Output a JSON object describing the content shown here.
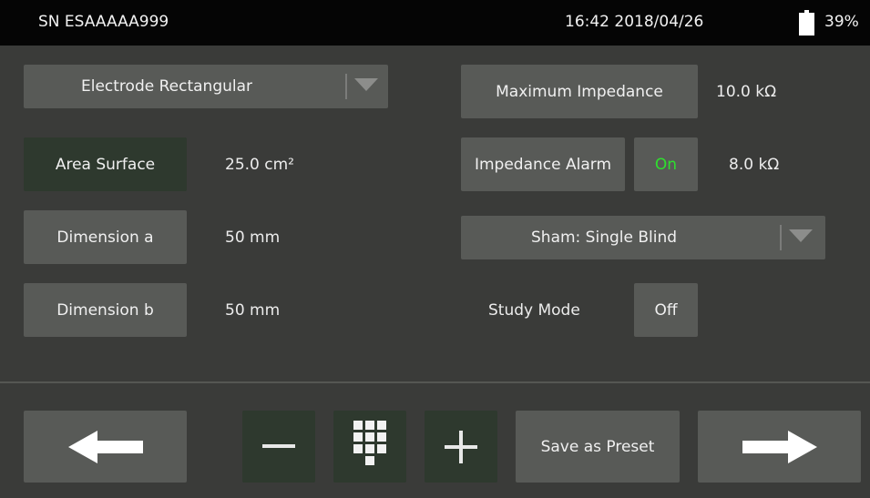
{
  "status_bar": {
    "serial": "SN ESAAAAA999",
    "datetime": "16:42 2018/04/26",
    "battery_percent": "39%",
    "battery_level": 0.39
  },
  "electrode": {
    "dropdown_value": "Electrode Rectangular",
    "area_button": "Area Surface",
    "area_value": "25.0 cm²",
    "dim_a_button": "Dimension a",
    "dim_a_value": "50 mm",
    "dim_b_button": "Dimension b",
    "dim_b_value": "50 mm"
  },
  "impedance": {
    "max_button": "Maximum Impedance",
    "max_value": "10.0 kΩ",
    "alarm_button": "Impedance Alarm",
    "alarm_toggle": "On",
    "alarm_value": "8.0 kΩ"
  },
  "sham": {
    "dropdown_value": "Sham: Single Blind"
  },
  "study_mode": {
    "label": "Study Mode",
    "toggle": "Off"
  },
  "footer": {
    "save_preset": "Save as Preset",
    "icons": [
      "arrow-left-icon",
      "minus-icon",
      "keypad-icon",
      "plus-icon",
      "arrow-right-icon"
    ]
  },
  "colors": {
    "background": "#3a3b39",
    "button": "#585a57",
    "button_dark": "#2e392e",
    "toggle_on": "#2ee02e",
    "status_bar": "#050505"
  }
}
